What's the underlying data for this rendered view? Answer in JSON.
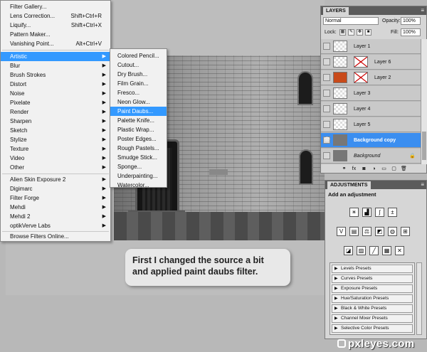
{
  "callout": {
    "line1": "First I changed the source a bit",
    "line2": "and applied paint daubs filter."
  },
  "filter_menu": {
    "top_items": [
      {
        "label": "Filter Gallery...",
        "shortcut": ""
      },
      {
        "label": "Lens Correction...",
        "shortcut": "Shift+Ctrl+R"
      },
      {
        "label": "Liquify...",
        "shortcut": "Shift+Ctrl+X"
      },
      {
        "label": "Pattern Maker...",
        "shortcut": ""
      },
      {
        "label": "Vanishing Point...",
        "shortcut": "Alt+Ctrl+V"
      }
    ],
    "categories": [
      "Artistic",
      "Blur",
      "Brush Strokes",
      "Distort",
      "Noise",
      "Pixelate",
      "Render",
      "Sharpen",
      "Sketch",
      "Stylize",
      "Texture",
      "Video",
      "Other"
    ],
    "plugins": [
      "Alien Skin Exposure 2",
      "Digimarc",
      "Filter Forge",
      "Mehdi",
      "Mehdi 2",
      "optikVerve Labs"
    ],
    "browse": "Browse Filters Online...",
    "highlighted": "Artistic"
  },
  "artistic_submenu": {
    "items": [
      "Colored Pencil...",
      "Cutout...",
      "Dry Brush...",
      "Film Grain...",
      "Fresco...",
      "Neon Glow...",
      "Paint Daubs...",
      "Palette Knife...",
      "Plastic Wrap...",
      "Poster Edges...",
      "Rough Pastels...",
      "Smudge Stick...",
      "Sponge...",
      "Underpainting...",
      "Watercolor..."
    ],
    "highlighted": "Paint Daubs..."
  },
  "layers_panel": {
    "tab": "LAYERS",
    "blend_mode": "Normal",
    "opacity_label": "Opacity:",
    "opacity": "100%",
    "lock_label": "Lock:",
    "fill_label": "Fill:",
    "fill": "100%",
    "layers": [
      {
        "name": "Layer 1"
      },
      {
        "name": "Layer 6"
      },
      {
        "name": "Layer 2"
      },
      {
        "name": "Layer 3"
      },
      {
        "name": "Layer 4"
      },
      {
        "name": "Layer 5"
      },
      {
        "name": "Background copy"
      },
      {
        "name": "Background"
      }
    ],
    "active_layer": "Background copy"
  },
  "adjustments_panel": {
    "tab": "ADJUSTMENTS",
    "title": "Add an adjustment",
    "presets": [
      "Levels Presets",
      "Curves Presets",
      "Exposure Presets",
      "Hue/Saturation Presets",
      "Black & White Presets",
      "Channel Mixer Presets",
      "Selective Color Presets"
    ]
  },
  "watermark": "pxleyes.com",
  "colors": {
    "highlight": "#3399ff",
    "active_layer": "#3b8ef0",
    "menu_bg": "#f1f1f1",
    "panel_bg": "#d6d6d6"
  }
}
